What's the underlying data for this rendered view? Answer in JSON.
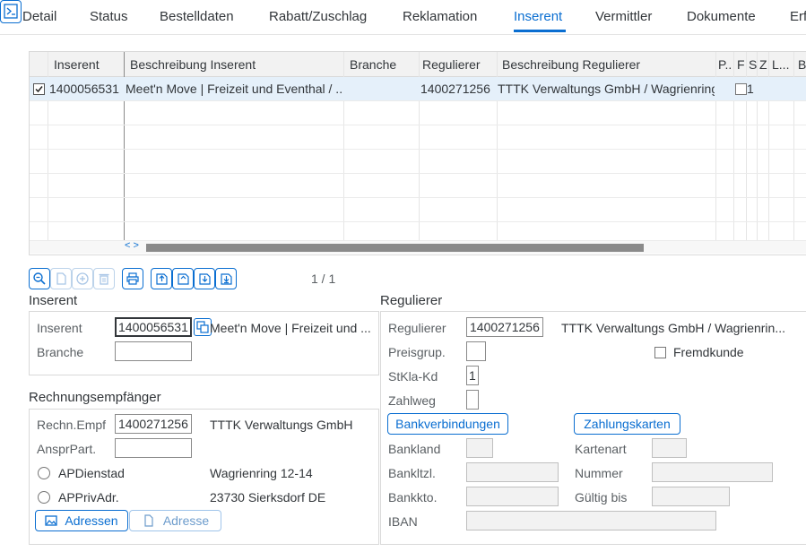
{
  "tabs": [
    {
      "label": "Detail",
      "active": false
    },
    {
      "label": "Status",
      "active": false
    },
    {
      "label": "Bestelldaten",
      "active": false
    },
    {
      "label": "Rabatt/Zuschlag",
      "active": false
    },
    {
      "label": "Reklamation",
      "active": false
    },
    {
      "label": "Inserent",
      "active": true
    },
    {
      "label": "Vermittler",
      "active": false
    },
    {
      "label": "Dokumente",
      "active": false
    },
    {
      "label": "Erf",
      "active": false
    }
  ],
  "table": {
    "headers": [
      "Inserent",
      "Beschreibung Inserent",
      "Branche",
      "Regulierer",
      "Beschreibung Regulierer",
      "P..",
      "F",
      "S",
      "Z",
      "L...",
      "B"
    ],
    "rows": [
      {
        "selected": true,
        "inserent": "1400056531",
        "beschreibung_inserent": "Meet'n Move | Freizeit und Eventhal / ...",
        "branche": "",
        "regulierer": "1400271256",
        "beschreibung_regulierer": "TTTK Verwaltungs GmbH / Wagrienring...",
        "s": "1"
      }
    ],
    "pagination": "1 / 1",
    "scroll_arrows": "< >"
  },
  "inserent": {
    "title": "Inserent",
    "inserent_label": "Inserent",
    "inserent_value": "1400056531",
    "inserent_desc": "Meet'n Move | Freizeit und ...",
    "branche_label": "Branche",
    "branche_value": ""
  },
  "rechnung": {
    "title": "Rechnungsempfänger",
    "empf_label": "Rechn.Empf",
    "empf_value": "1400271256",
    "empf_desc": "TTTK Verwaltungs GmbH",
    "anspr_label": "AnsprPart.",
    "anspr_value": "",
    "radio1_label": "APDienstad",
    "radio1_desc": "Wagrienring 12-14",
    "radio2_label": "APPrivAdr.",
    "radio2_desc": "23730 Sierksdorf DE",
    "btn_adressen": "Adressen",
    "btn_adresse": "Adresse"
  },
  "regulierer": {
    "title": "Regulierer",
    "regulierer_label": "Regulierer",
    "regulierer_value": "1400271256",
    "regulierer_desc": "TTTK Verwaltungs GmbH / Wagrienrin...",
    "preisgrup_label": "Preisgrup.",
    "preisgrup_value": "",
    "fremdkunde_label": "Fremdkunde",
    "stkla_label": "StKla-Kd",
    "stkla_value": "1",
    "zahlweg_label": "Zahlweg",
    "zahlweg_value": "",
    "btn_bank": "Bankverbindungen",
    "btn_zahlkarten": "Zahlungskarten",
    "bankland_label": "Bankland",
    "bankltzl_label": "Bankltzl.",
    "bankkto_label": "Bankkto.",
    "iban_label": "IBAN",
    "kartenart_label": "Kartenart",
    "nummer_label": "Nummer",
    "gueltig_label": "Gültig bis"
  },
  "colors": {
    "accent": "#0a6ed1",
    "selected_row": "#e5f0fa"
  }
}
